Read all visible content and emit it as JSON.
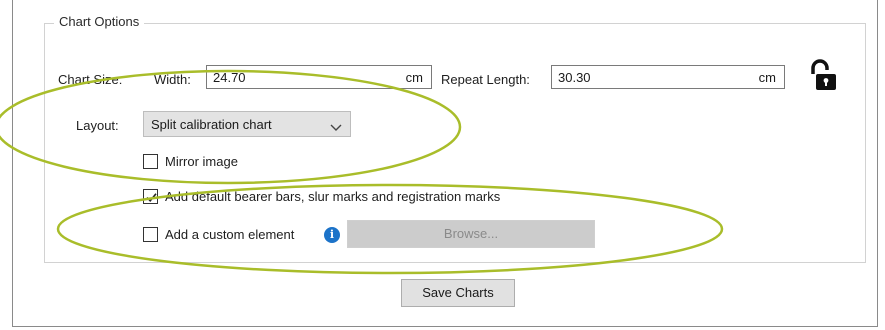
{
  "chart_options": {
    "group_title": "Chart Options",
    "chart_size_label": "Chart Size:",
    "width_label": "Width:",
    "width_value": "24.70",
    "width_unit": "cm",
    "repeat_length_label": "Repeat Length:",
    "repeat_length_value": "30.30",
    "repeat_length_unit": "cm",
    "layout_label": "Layout:",
    "layout_selected": "Split calibration chart",
    "mirror_image_label": "Mirror image",
    "mirror_image_checked": false,
    "bearer_bars_label": "Add default bearer bars, slur marks and registration marks",
    "bearer_bars_checked": true,
    "custom_element_label": "Add a custom element",
    "custom_element_checked": false,
    "browse_label": "Browse...",
    "save_label": "Save Charts"
  },
  "icons": {
    "lock": "unlocked-padlock-icon",
    "info": "info-icon",
    "chevron": "chevron-down-icon"
  },
  "colors": {
    "annotation_ellipse": "#a9bd2a",
    "info_icon": "#1c73c9"
  }
}
